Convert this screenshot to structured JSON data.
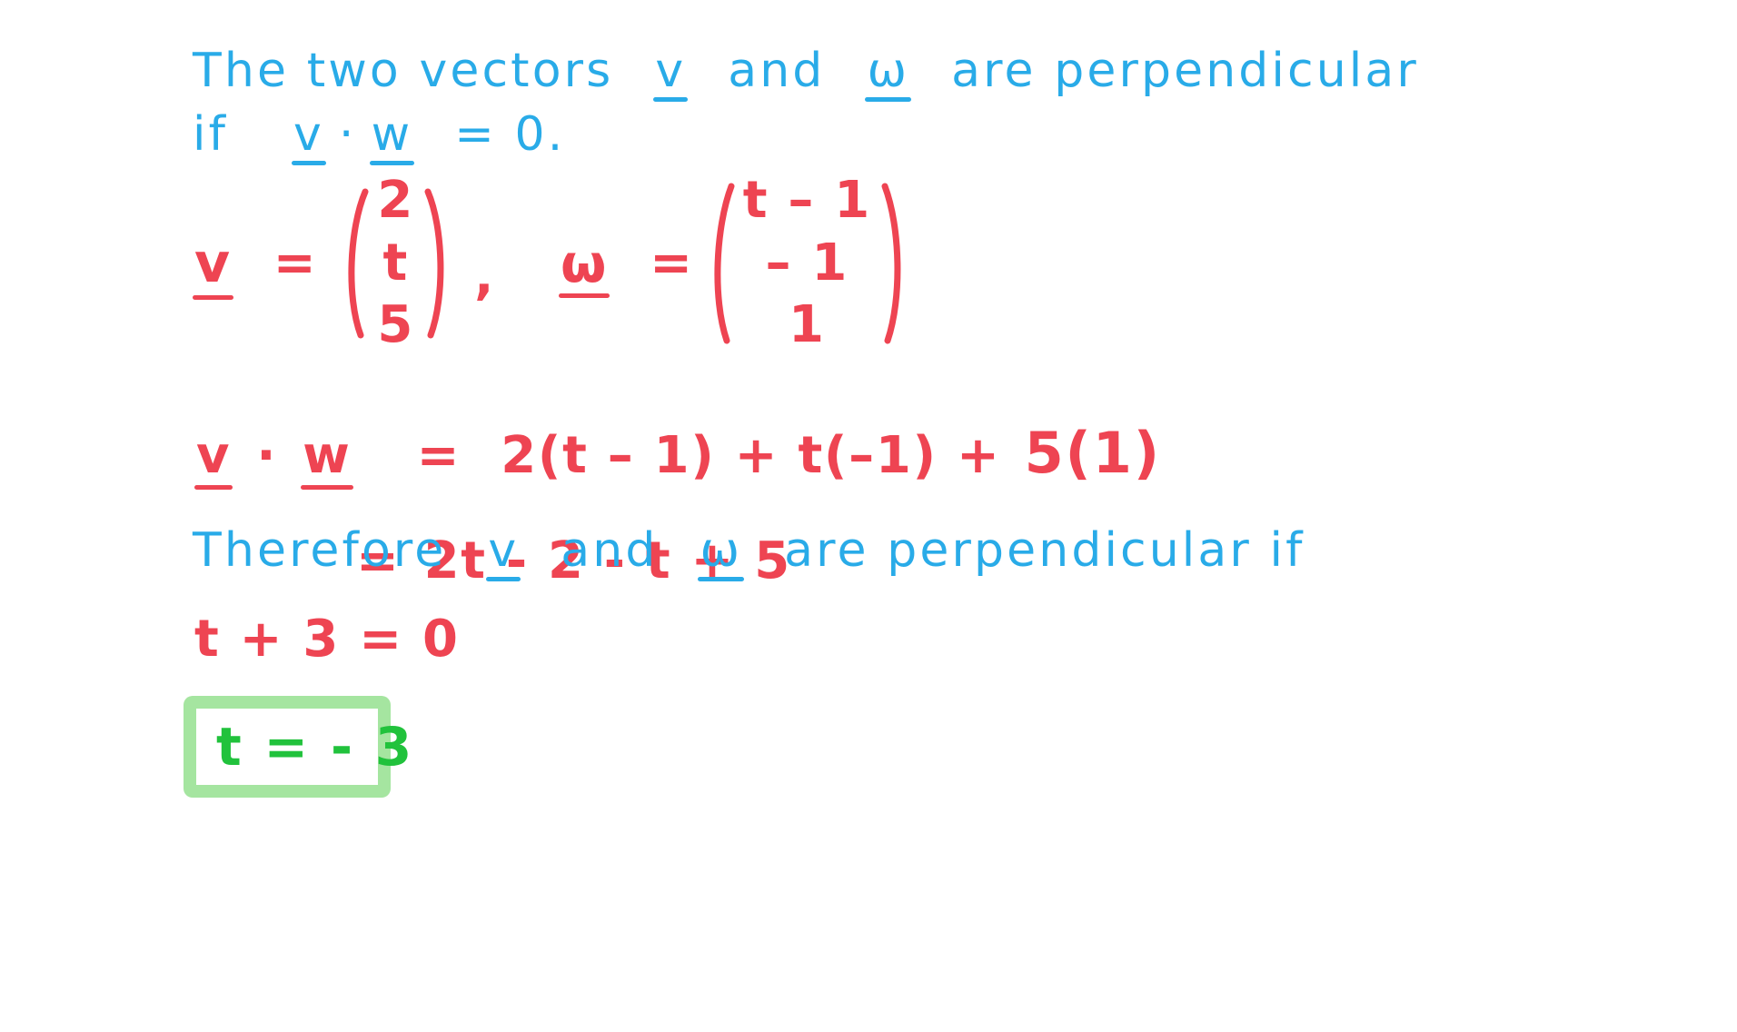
{
  "document": {
    "kind": "handwritten-math-solution",
    "background_color": "#ffffff",
    "ink_colors": {
      "statement_blue": "#29abe8",
      "working_red": "#ee4452",
      "answer_green": "#21c23c",
      "highlight_green": "#a5e5a0"
    }
  },
  "lines": {
    "statement1": {
      "part1": "The two vectors",
      "vector_v": "v",
      "part2": "and",
      "vector_w": "ω",
      "part3": "are perpendicular"
    },
    "statement2": {
      "part1": "if",
      "vector_v": "v",
      "dot": "·",
      "vector_w": "w",
      "part2": "= 0."
    },
    "definitions": {
      "v_label": "v",
      "v_equals": "=",
      "v_components": [
        "2",
        "t",
        "5"
      ],
      "comma": ",",
      "w_label": "ω",
      "w_equals": "=",
      "w_components": [
        "t – 1",
        "– 1",
        "1"
      ]
    },
    "dot_product": {
      "lhs_v": "v",
      "lhs_dot": "·",
      "lhs_w": "w",
      "equals": "=",
      "rhs": "2(t – 1) + t(–1) +",
      "rhs_last": "5(1)"
    },
    "simplify": {
      "equals": "=",
      "expression": "2t - 2 - t + 5"
    },
    "conclusion": {
      "part1": "Therefore",
      "vector_v": "v",
      "part2": "and",
      "vector_w": "ω",
      "part3": "are perpendicular  if"
    },
    "equation": {
      "text": "t + 3 = 0"
    },
    "answer": {
      "text": "t = - 3"
    }
  }
}
